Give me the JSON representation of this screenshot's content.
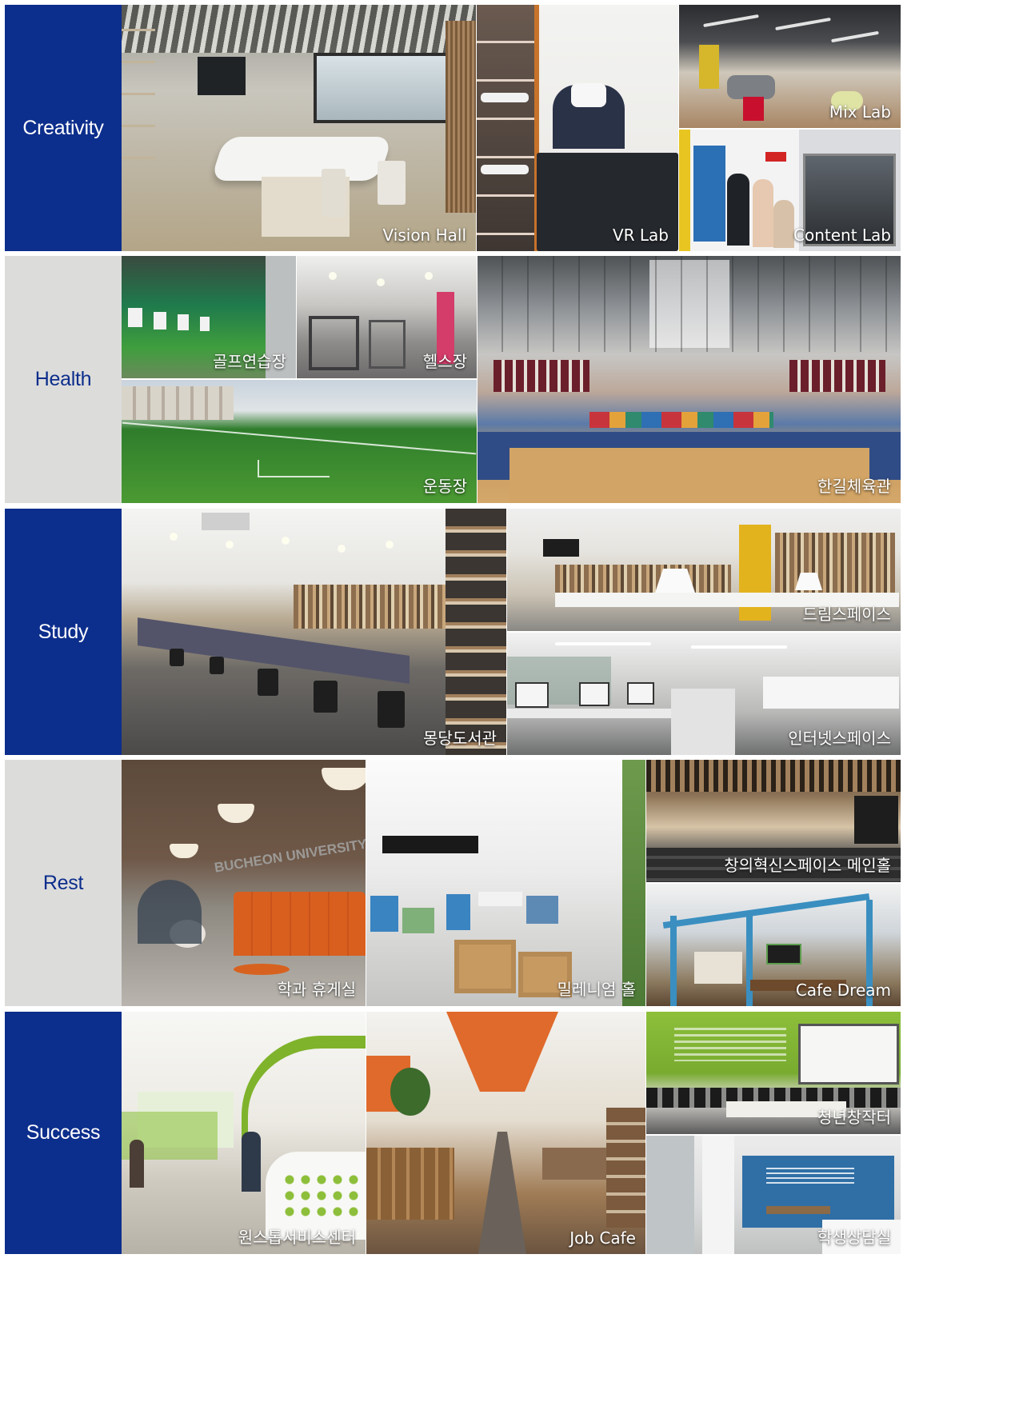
{
  "rows": [
    {
      "label": "Creativity",
      "photos": [
        {
          "caption": "Vision Hall"
        },
        {
          "caption": "VR Lab"
        },
        {
          "caption": "Mix Lab"
        },
        {
          "caption": "Content Lab"
        }
      ]
    },
    {
      "label": "Health",
      "photos": [
        {
          "caption": "골프연습장"
        },
        {
          "caption": "헬스장"
        },
        {
          "caption": "운동장"
        },
        {
          "caption": "한길체육관"
        }
      ]
    },
    {
      "label": "Study",
      "photos": [
        {
          "caption": "몽당도서관"
        },
        {
          "caption": "드림스페이스"
        },
        {
          "caption": "인터넷스페이스"
        }
      ]
    },
    {
      "label": "Rest",
      "photos": [
        {
          "caption": "학과 휴게실"
        },
        {
          "caption": "밀레니엄 홀"
        },
        {
          "caption": "창의혁신스페이스 메인홀"
        },
        {
          "caption": "Cafe Dream"
        }
      ],
      "signage": "BUCHEON UNIVERSITY LOU"
    },
    {
      "label": "Success",
      "photos": [
        {
          "caption": "원스톱서비스센터"
        },
        {
          "caption": "Job Cafe"
        },
        {
          "caption": "청년창작터"
        },
        {
          "caption": "학생상담실"
        }
      ]
    }
  ],
  "colors": {
    "navy": "#0c2e8c",
    "light_gray": "#dcdcdb",
    "caption": "#ffffff"
  }
}
